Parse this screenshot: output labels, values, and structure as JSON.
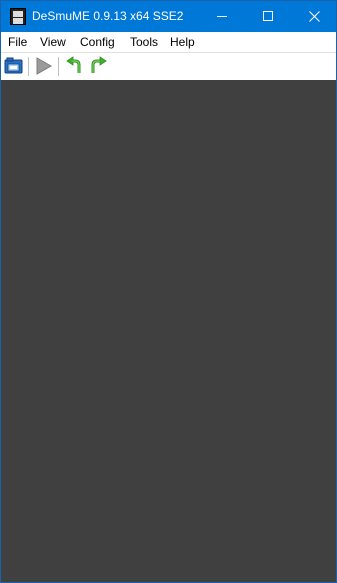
{
  "window": {
    "title": "DeSmuME 0.9.13 x64 SSE2",
    "app_icon": "desmume-ds-icon",
    "title_bar_color": "#0078d7",
    "controls": {
      "minimize_icon": "minimize-icon",
      "maximize_icon": "maximize-icon",
      "close_icon": "close-icon"
    }
  },
  "menu": {
    "items": [
      {
        "label": "File"
      },
      {
        "label": "View"
      },
      {
        "label": "Config"
      },
      {
        "label": "Tools"
      },
      {
        "label": "Help"
      }
    ]
  },
  "toolbar": {
    "buttons": [
      {
        "icon": "open-rom-icon"
      },
      {
        "icon": "play-icon",
        "enabled": false
      },
      {
        "icon": "rotate-left-icon"
      },
      {
        "icon": "rotate-right-icon"
      }
    ]
  },
  "display": {
    "background": "#404040"
  }
}
